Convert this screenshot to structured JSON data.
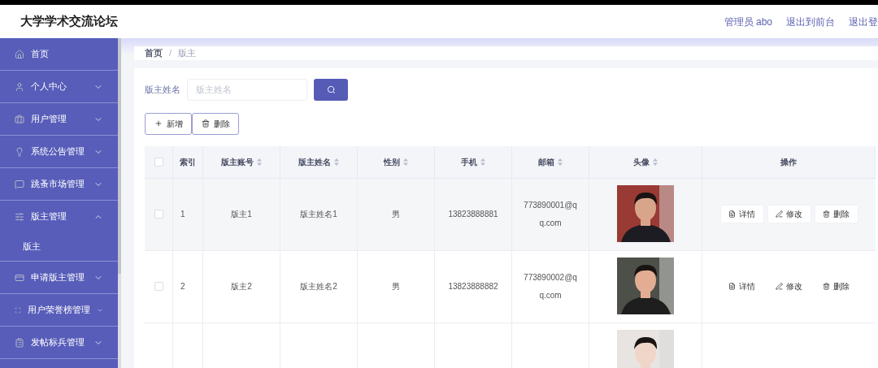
{
  "header": {
    "title": "大学学术交流论坛",
    "links": [
      "管理员 abo",
      "退出到前台",
      "退出登"
    ]
  },
  "sidebar": {
    "items": [
      {
        "label": "首页"
      },
      {
        "label": "个人中心",
        "expanded": false
      },
      {
        "label": "用户管理",
        "expanded": false
      },
      {
        "label": "系统公告管理",
        "expanded": false
      },
      {
        "label": "跳蚤市场管理",
        "expanded": false
      },
      {
        "label": "版主管理",
        "expanded": true,
        "children": [
          {
            "label": "版主"
          }
        ]
      },
      {
        "label": "申请版主管理",
        "expanded": false
      },
      {
        "label": "用户荣誉榜管理",
        "expanded": false
      },
      {
        "label": "发帖标兵管理",
        "expanded": false
      }
    ]
  },
  "breadcrumb": {
    "items": [
      "首页",
      "版主"
    ],
    "separator": "/"
  },
  "search": {
    "label": "版主姓名",
    "placeholder": "版主姓名"
  },
  "actions": [
    {
      "label": "新增"
    },
    {
      "label": "删除"
    }
  ],
  "table": {
    "select_all_checked": false,
    "columns": [
      {
        "label": "索引",
        "sortable": false
      },
      {
        "label": "版主账号",
        "sortable": true
      },
      {
        "label": "版主姓名",
        "sortable": true
      },
      {
        "label": "性别",
        "sortable": true
      },
      {
        "label": "手机",
        "sortable": true
      },
      {
        "label": "邮箱",
        "sortable": true
      },
      {
        "label": "头像",
        "sortable": true
      },
      {
        "label": "操作",
        "sortable": false
      }
    ],
    "rows": [
      {
        "checked": false,
        "highlighted": true,
        "cells": [
          "1",
          "版主1",
          "版主姓名1",
          "男",
          "13823888881",
          "773890001@qq.com"
        ],
        "avatar": {
          "kind": "picture"
        },
        "buttons": [
          {
            "label": "详情"
          },
          {
            "label": "修改"
          },
          {
            "label": "删除"
          }
        ]
      },
      {
        "checked": false,
        "highlighted": false,
        "cells": [
          "2",
          "版主2",
          "版主姓名2",
          "男",
          "13823888882",
          "773890002@qq.com"
        ],
        "avatar": {
          "kind": "picture"
        },
        "buttons": [
          {
            "label": "详情"
          },
          {
            "label": "修改"
          },
          {
            "label": "删除"
          }
        ]
      },
      {
        "avatar": {
          "kind": "picture"
        }
      }
    ]
  }
}
